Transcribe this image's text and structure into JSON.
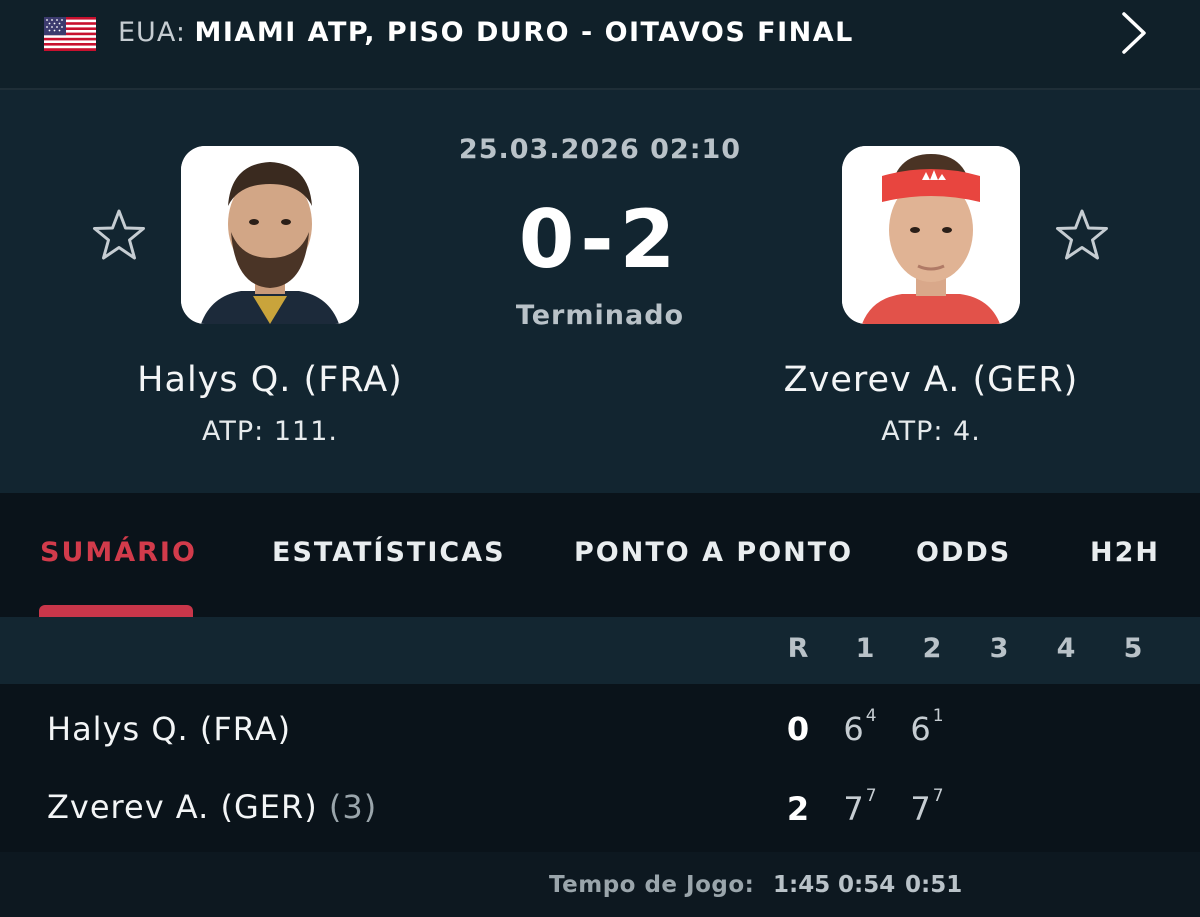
{
  "league": {
    "country": "EUA:",
    "name": "MIAMI ATP, PISO DURO - OITAVOS FINAL",
    "flag": "usa-flag",
    "next_icon": "chevron-right-icon"
  },
  "match": {
    "datetime": "25.03.2026 02:10",
    "score": "0-2",
    "status": "Terminado"
  },
  "players": [
    {
      "name": "Halys Q. (FRA)",
      "rank": "ATP: 111.",
      "favorite_icon": "star-outline-icon"
    },
    {
      "name": "Zverev A. (GER)",
      "rank": "ATP: 4.",
      "favorite_icon": "star-outline-icon"
    }
  ],
  "tabs": [
    {
      "label": "SUMÁRIO",
      "active": true
    },
    {
      "label": "ESTATÍSTICAS",
      "active": false
    },
    {
      "label": "PONTO A PONTO",
      "active": false
    },
    {
      "label": "ODDS",
      "active": false
    },
    {
      "label": "H2H",
      "active": false
    }
  ],
  "scoreboard": {
    "columns": [
      "R",
      "1",
      "2",
      "3",
      "4",
      "5"
    ],
    "rows": [
      {
        "name": "Halys Q. (FRA)",
        "seed": "",
        "result": "0",
        "sets": [
          {
            "games": "6",
            "tiebreak": "4"
          },
          {
            "games": "6",
            "tiebreak": "1"
          }
        ]
      },
      {
        "name": "Zverev A. (GER)",
        "seed": "(3)",
        "result": "2",
        "sets": [
          {
            "games": "7",
            "tiebreak": "7"
          },
          {
            "games": "7",
            "tiebreak": "7"
          }
        ]
      }
    ]
  },
  "footer": {
    "label": "Tempo de Jogo:",
    "total": "1:45",
    "set_times": [
      "0:54",
      "0:51"
    ]
  },
  "colors": {
    "accent": "#d23b4b",
    "background": "#0d1820",
    "header_bg": "#122530"
  }
}
